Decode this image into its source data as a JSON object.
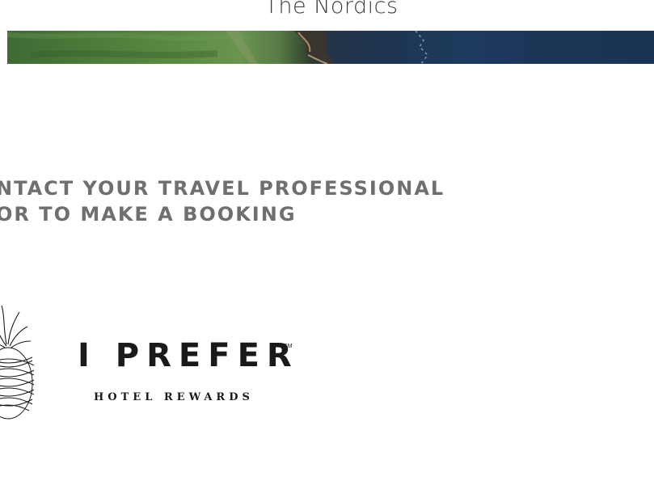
{
  "region": {
    "title": "The Nordics"
  },
  "banner": {
    "image": "coastline aerial photo"
  },
  "cta": {
    "line1": "NTACT YOUR TRAVEL PROFESSIONAL",
    "line2": "OR TO MAKE A BOOKING"
  },
  "brand": {
    "name": "I PREFER",
    "mark": "SM",
    "tagline": "HOTEL REWARDS",
    "logo_icon": "pineapple-icon"
  },
  "colors": {
    "heading": "#6d6f70",
    "brand_text": "#1a1a1a",
    "title_text": "#3a3a3a"
  }
}
